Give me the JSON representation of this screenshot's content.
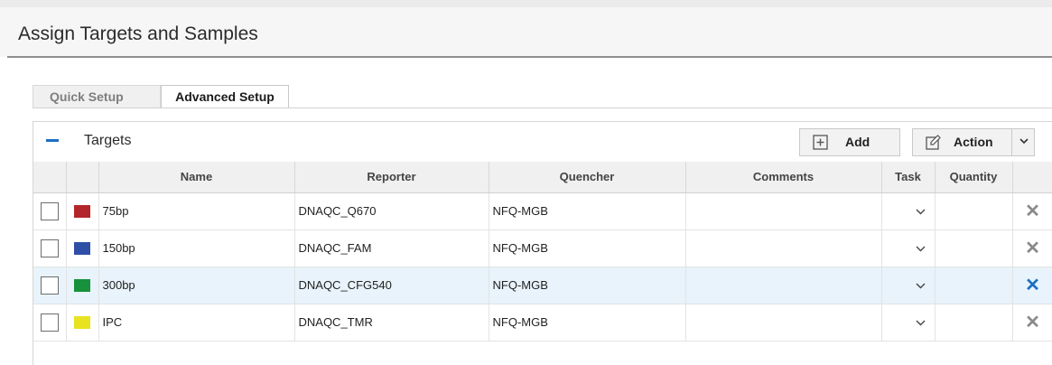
{
  "page": {
    "title": "Assign Targets and Samples"
  },
  "tabs": [
    {
      "label": "Quick Setup",
      "active": false
    },
    {
      "label": "Advanced Setup",
      "active": true
    }
  ],
  "targets": {
    "section_title": "Targets",
    "collapse_icon": "minus-icon",
    "add_label": "Add",
    "add_icon": "plus-box-icon",
    "action_label": "Action",
    "action_icon": "edit-icon",
    "dropdown_icon": "chevron-down-icon",
    "columns": [
      "Name",
      "Reporter",
      "Quencher",
      "Comments",
      "Task",
      "Quantity"
    ],
    "rows": [
      {
        "color": "#b3262b",
        "name": "75bp",
        "reporter": "DNAQC_Q670",
        "quencher": "NFQ-MGB",
        "comments": "",
        "quantity": "",
        "selected": false
      },
      {
        "color": "#2f4fa6",
        "name": "150bp",
        "reporter": "DNAQC_FAM",
        "quencher": "NFQ-MGB",
        "comments": "",
        "quantity": "",
        "selected": false
      },
      {
        "color": "#17913c",
        "name": "300bp",
        "reporter": "DNAQC_CFG540",
        "quencher": "NFQ-MGB",
        "comments": "",
        "quantity": "",
        "selected": true
      },
      {
        "color": "#e8e21f",
        "name": "IPC",
        "reporter": "DNAQC_TMR",
        "quencher": "NFQ-MGB",
        "comments": "",
        "quantity": "",
        "selected": false
      }
    ],
    "delete_icon": "close-icon"
  },
  "colors": {
    "accent": "#1a6fc2",
    "selected_row": "#e8f3fb"
  }
}
